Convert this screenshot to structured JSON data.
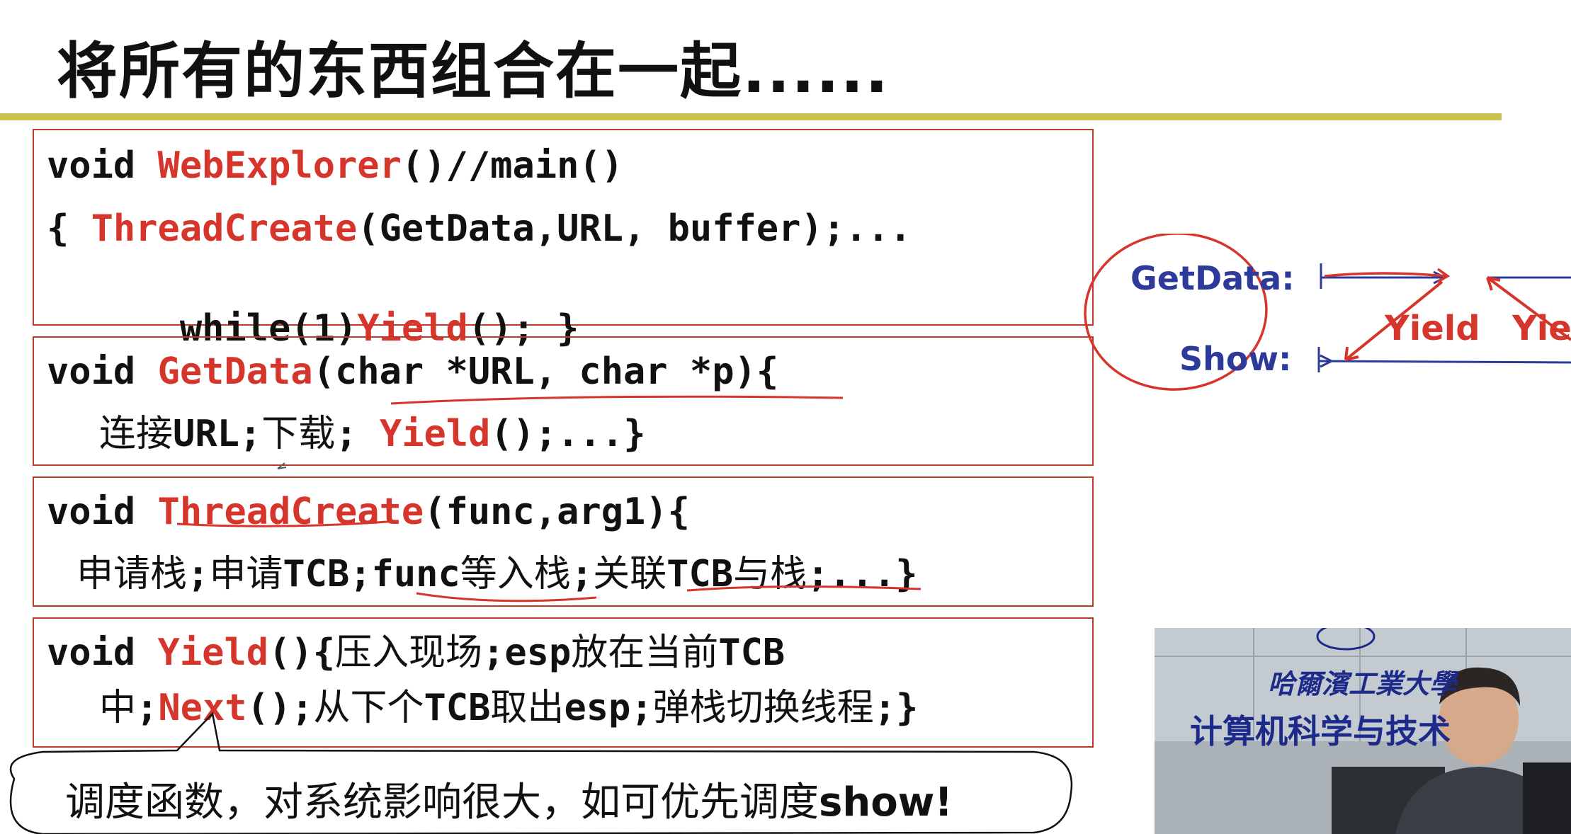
{
  "slide": {
    "title": "将所有的东西组合在一起......"
  },
  "code_blocks": {
    "webexplorer": {
      "l1_kw": "void ",
      "l1_fn": "WebExplorer",
      "l1_rest": "()//main()",
      "l2_brace": "{ ",
      "l2_fn": "ThreadCreate",
      "l2_rest": "(GetData,URL, buffer);...",
      "l3_pre": "  while(1)",
      "l3_fn": "Yield",
      "l3_rest": "(); }"
    },
    "getdata": {
      "l1_kw": "void ",
      "l1_fn": "GetData",
      "l1_rest": "(char *URL, char *p){",
      "l2_cn1": "连接",
      "l2_a": "URL;",
      "l2_cn2": "下载",
      "l2_b": "; ",
      "l2_fn": "Yield",
      "l2_rest": "();...}"
    },
    "threadcreate": {
      "l1_kw": "void ",
      "l1_fn": "ThreadCreate",
      "l1_rest": "(func,arg1){",
      "l2_cn1": "申请栈",
      "l2_a": ";",
      "l2_cn2": "申请",
      "l2_b": "TCB;func",
      "l2_cn3": "等入栈",
      "l2_c": ";",
      "l2_cn4": "关联",
      "l2_d": "TCB",
      "l2_cn5": "与栈",
      "l2_e": ";...}"
    },
    "yield": {
      "l1_kw": "void ",
      "l1_fn": "Yield",
      "l1_a": "(){",
      "l1_cn1": "压入现场",
      "l1_b": ";esp",
      "l1_cn2": "放在当前",
      "l1_c": "TCB",
      "l2_cn1": "中",
      "l2_a": ";",
      "l2_fn": "Next",
      "l2_b": "();",
      "l2_cn2": "从下个",
      "l2_c": "TCB",
      "l2_cn3": "取出",
      "l2_d": "esp;",
      "l2_cn4": "弹栈切换线程",
      "l2_e": ";}"
    }
  },
  "callout": {
    "text": "调度函数，对系统影响很大，如可优先调度",
    "bold": "show!"
  },
  "diagram": {
    "label_getdata": "GetData:",
    "label_show": "Show:",
    "yield_1": "Yield",
    "yield_2": "Yie"
  },
  "video": {
    "university": "哈爾濱工業大學",
    "department": "计算机科学与技术"
  },
  "colors": {
    "keyword_red": "#d5352a",
    "box_border": "#c0392b",
    "rule": "#c9c24e",
    "diagram_blue": "#2e3a9a"
  }
}
